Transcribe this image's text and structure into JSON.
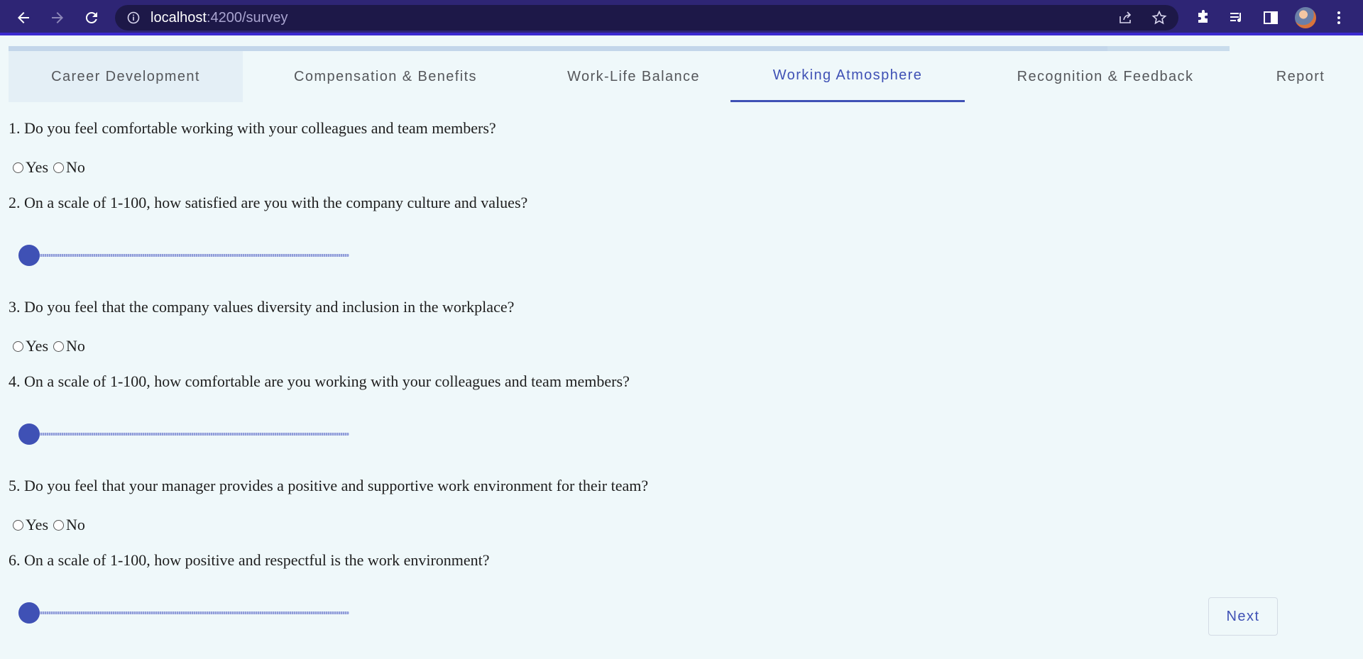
{
  "browser": {
    "url_host": "localhost",
    "url_rest": ":4200/survey"
  },
  "colors": {
    "accent": "#3f51b5",
    "chrome_bg": "#2e2575",
    "page_bg": "#eff8fa"
  },
  "progress": {
    "fraction": 0.9
  },
  "tabs": [
    {
      "label": "Career Development"
    },
    {
      "label": "Compensation & Benefits"
    },
    {
      "label": "Work-Life Balance"
    },
    {
      "label": "Working Atmosphere",
      "active": true
    },
    {
      "label": "Recognition & Feedback"
    },
    {
      "label": "Report"
    }
  ],
  "questions": [
    {
      "text": "1. Do you feel comfortable working with your colleagues and team members?",
      "type": "radio",
      "options": [
        "Yes",
        "No"
      ]
    },
    {
      "text": "2. On a scale of 1-100, how satisfied are you with the company culture and values?",
      "type": "slider",
      "value": 1
    },
    {
      "text": "3. Do you feel that the company values diversity and inclusion in the workplace?",
      "type": "radio",
      "options": [
        "Yes",
        "No"
      ]
    },
    {
      "text": "4. On a scale of 1-100, how comfortable are you working with your colleagues and team members?",
      "type": "slider",
      "value": 1
    },
    {
      "text": "5. Do you feel that your manager provides a positive and supportive work environment for their team?",
      "type": "radio",
      "options": [
        "Yes",
        "No"
      ]
    },
    {
      "text": "6. On a scale of 1-100, how positive and respectful is the work environment?",
      "type": "slider",
      "value": 1
    }
  ],
  "actions": {
    "next_label": "Next"
  }
}
